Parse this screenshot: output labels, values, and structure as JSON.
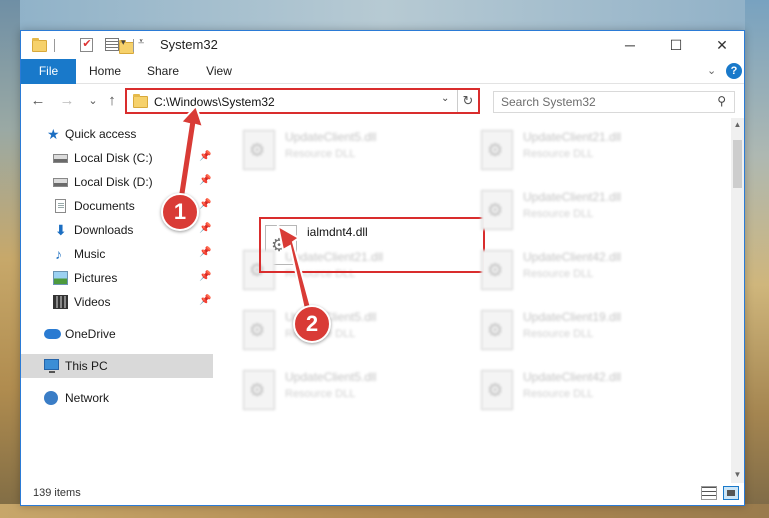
{
  "window": {
    "title": "System32",
    "controls": {
      "minimize": "─",
      "maximize": "☐",
      "close": "✕"
    }
  },
  "ribbon": {
    "tabs": [
      "File",
      "Home",
      "Share",
      "View"
    ]
  },
  "navbar": {
    "back": "←",
    "forward": "→",
    "recent": "⌄",
    "up": "↑",
    "address": "C:\\Windows\\System32",
    "address_dropdown": "⌄",
    "refresh": "↻",
    "search_placeholder": "Search System32"
  },
  "sidebar": {
    "items": [
      {
        "label": "Quick access",
        "icon": "star-icon"
      },
      {
        "label": "Local Disk (C:)",
        "icon": "disk-icon",
        "pinned": true
      },
      {
        "label": "Local Disk (D:)",
        "icon": "disk-icon",
        "pinned": true
      },
      {
        "label": "Documents",
        "icon": "documents-icon",
        "pinned": true
      },
      {
        "label": "Downloads",
        "icon": "download-icon",
        "pinned": true
      },
      {
        "label": "Music",
        "icon": "music-icon",
        "pinned": true
      },
      {
        "label": "Pictures",
        "icon": "pictures-icon",
        "pinned": true
      },
      {
        "label": "Videos",
        "icon": "videos-icon",
        "pinned": true
      },
      {
        "label": "OneDrive",
        "icon": "cloud-icon"
      },
      {
        "label": "This PC",
        "icon": "computer-icon",
        "selected": true
      },
      {
        "label": "Network",
        "icon": "network-icon"
      }
    ]
  },
  "files": {
    "highlighted": {
      "name": "ialmdnt4.dll"
    },
    "left": [
      {
        "name": "UpdateClient5.dll",
        "type": "Resource DLL"
      },
      {
        "name": "UpdateClient21.dll",
        "type": "Resource DLL"
      },
      {
        "name": "UpdateClient5.dll",
        "type": "Resource DLL"
      },
      {
        "name": "UpdateClient5.dll",
        "type": "Resource DLL"
      }
    ],
    "right": [
      {
        "name": "UpdateClient21.dll",
        "type": "Resource DLL"
      },
      {
        "name": "UpdateClient21.dll",
        "type": "Resource DLL"
      },
      {
        "name": "UpdateClient42.dll",
        "type": "Resource DLL"
      },
      {
        "name": "UpdateClient19.dll",
        "type": "Resource DLL"
      },
      {
        "name": "UpdateClient42.dll",
        "type": "Resource DLL"
      }
    ]
  },
  "status": {
    "item_count": "139 items"
  },
  "callouts": {
    "step1": "1",
    "step2": "2"
  },
  "colors": {
    "accent": "#1979ca",
    "highlight": "#d92d2d",
    "callout": "#d93b36"
  }
}
